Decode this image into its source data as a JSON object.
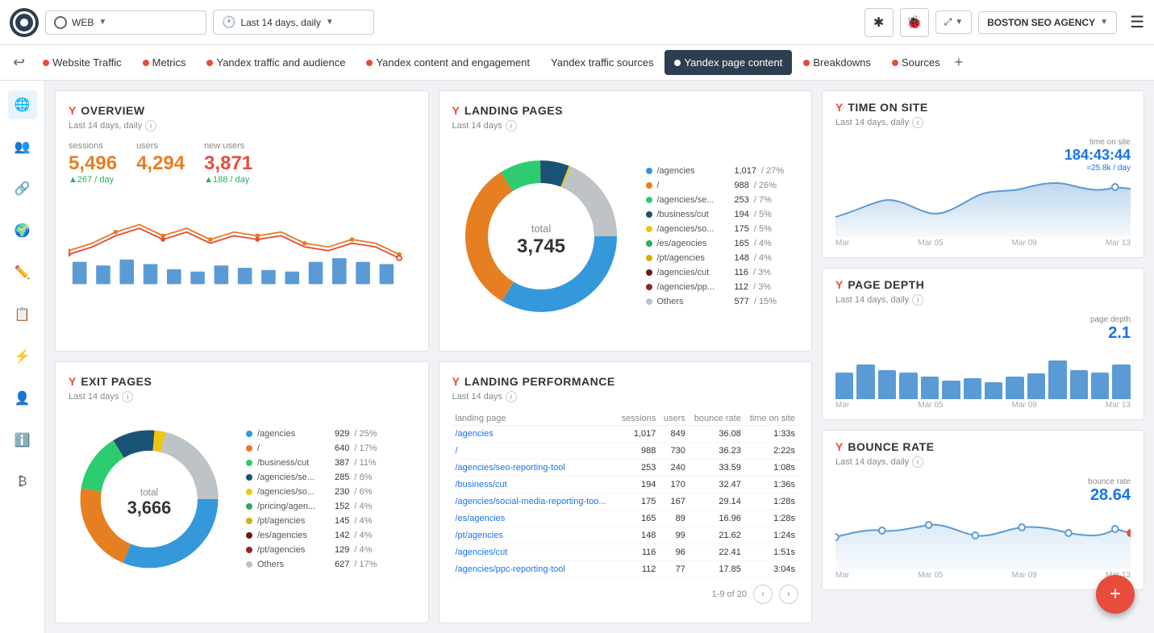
{
  "topbar": {
    "logo_label": "Logo",
    "web_label": "WEB",
    "date_label": "Last 14 days, daily",
    "agency_label": "BOSTON SEO AGENCY",
    "menu_icon": "☰"
  },
  "navbar": {
    "tabs": [
      {
        "id": "website-traffic",
        "label": "Website Traffic",
        "color": "#e74c3c",
        "active": false
      },
      {
        "id": "metrics",
        "label": "Metrics",
        "color": "#e74c3c",
        "active": false
      },
      {
        "id": "yandex-traffic",
        "label": "Yandex traffic and audience",
        "color": "#e74c3c",
        "active": false
      },
      {
        "id": "yandex-content",
        "label": "Yandex content and engagement",
        "color": "#e74c3c",
        "active": false
      },
      {
        "id": "yandex-sources",
        "label": "Yandex traffic sources",
        "color": "#e74c3c",
        "active": false
      },
      {
        "id": "yandex-page",
        "label": "Yandex page content",
        "color": "#e74c3c",
        "active": true
      },
      {
        "id": "breakdowns",
        "label": "Breakdowns",
        "color": "#e74c3c",
        "active": false
      },
      {
        "id": "sources",
        "label": "Sources",
        "color": "#e74c3c",
        "active": false
      }
    ],
    "add_label": "+"
  },
  "sidebar": {
    "icons": [
      "🌐",
      "👥",
      "🔗",
      "🌍",
      "✏️",
      "📋",
      "⚡",
      "👤",
      "ℹ️",
      "₿"
    ]
  },
  "overview": {
    "title": "OVERVIEW",
    "subtitle": "Last 14 days, daily",
    "sessions_label": "sessions",
    "sessions_value": "5,496",
    "sessions_change": "▲267 / day",
    "users_label": "users",
    "users_value": "4,294",
    "new_users_label": "new users",
    "new_users_value": "3,871",
    "new_users_change": "▲188 / day"
  },
  "landing_pages": {
    "title": "LANDING PAGES",
    "subtitle": "Last 14 days",
    "total_label": "total",
    "total_value": "3,745",
    "items": [
      {
        "name": "/agencies",
        "value": "1,017",
        "pct": "27%",
        "color": "#3498db"
      },
      {
        "name": "/",
        "value": "988",
        "pct": "26%",
        "color": "#e67e22"
      },
      {
        "name": "/agencies/se...",
        "value": "253",
        "pct": "7%",
        "color": "#2ecc71"
      },
      {
        "name": "/business/cut",
        "value": "194",
        "pct": "5%",
        "color": "#1a5276"
      },
      {
        "name": "/agencies/so...",
        "value": "175",
        "pct": "5%",
        "color": "#f1c40f"
      },
      {
        "name": "/es/agencies",
        "value": "165",
        "pct": "4%",
        "color": "#27ae60"
      },
      {
        "name": "/pt/agencies",
        "value": "148",
        "pct": "4%",
        "color": "#d4ac0d"
      },
      {
        "name": "/agencies/cut",
        "value": "116",
        "pct": "3%",
        "color": "#6c1a1a"
      },
      {
        "name": "/agencies/pp...",
        "value": "112",
        "pct": "3%",
        "color": "#922b21"
      },
      {
        "name": "Others",
        "value": "577",
        "pct": "15%",
        "color": "#bdc3c7"
      }
    ]
  },
  "exit_pages": {
    "title": "EXIT PAGES",
    "subtitle": "Last 14 days",
    "total_label": "total",
    "total_value": "3,666",
    "items": [
      {
        "name": "/agencies",
        "value": "929",
        "pct": "25%",
        "color": "#3498db"
      },
      {
        "name": "/",
        "value": "640",
        "pct": "17%",
        "color": "#e67e22"
      },
      {
        "name": "/business/cut",
        "value": "387",
        "pct": "11%",
        "color": "#2ecc71"
      },
      {
        "name": "/agencies/se...",
        "value": "285",
        "pct": "8%",
        "color": "#1a5276"
      },
      {
        "name": "/agencies/so...",
        "value": "230",
        "pct": "6%",
        "color": "#f1c40f"
      },
      {
        "name": "/pricing/agen...",
        "value": "152",
        "pct": "4%",
        "color": "#27ae60"
      },
      {
        "name": "/pt/agencies",
        "value": "145",
        "pct": "4%",
        "color": "#d4ac0d"
      },
      {
        "name": "/es/agencies",
        "value": "142",
        "pct": "4%",
        "color": "#6c1a1a"
      },
      {
        "name": "/pt/agencies",
        "value": "129",
        "pct": "4%",
        "color": "#922b21"
      },
      {
        "name": "Others",
        "value": "627",
        "pct": "17%",
        "color": "#bdc3c7"
      }
    ]
  },
  "landing_perf": {
    "title": "LANDING PERFORMANCE",
    "subtitle": "Last 14 days",
    "col_landing": "landing page",
    "col_sessions": "sessions",
    "col_users": "users",
    "col_bounce": "bounce rate",
    "col_time": "time on site",
    "rows": [
      {
        "page": "/agencies",
        "sessions": "1,017",
        "users": "849",
        "bounce": "36.08",
        "time": "1:33s"
      },
      {
        "page": "/",
        "sessions": "988",
        "users": "730",
        "bounce": "36.23",
        "time": "2:22s"
      },
      {
        "page": "/agencies/seo-reporting-tool",
        "sessions": "253",
        "users": "240",
        "bounce": "33.59",
        "time": "1:08s"
      },
      {
        "page": "/business/cut",
        "sessions": "194",
        "users": "170",
        "bounce": "32.47",
        "time": "1:36s"
      },
      {
        "page": "/agencies/social-media-reporting-too...",
        "sessions": "175",
        "users": "167",
        "bounce": "29.14",
        "time": "1:28s"
      },
      {
        "page": "/es/agencies",
        "sessions": "165",
        "users": "89",
        "bounce": "16.96",
        "time": "1:28s"
      },
      {
        "page": "/pt/agencies",
        "sessions": "148",
        "users": "99",
        "bounce": "21.62",
        "time": "1:24s"
      },
      {
        "page": "/agencies/cut",
        "sessions": "116",
        "users": "96",
        "bounce": "22.41",
        "time": "1:51s"
      },
      {
        "page": "/agencies/ppc-reporting-tool",
        "sessions": "112",
        "users": "77",
        "bounce": "17.85",
        "time": "3:04s"
      }
    ],
    "pagination": "1-9 of 20"
  },
  "time_on_site": {
    "title": "TIME ON SITE",
    "subtitle": "Last 14 days, daily",
    "label": "time on site",
    "value": "184:43:44",
    "sub_value": "≈25.8k / day",
    "axes": [
      "Mar",
      "Mar 05",
      "Mar 09",
      "Mar 13"
    ]
  },
  "page_depth": {
    "title": "PAGE DEPTH",
    "subtitle": "Last 14 days, daily",
    "label": "page depth",
    "value": "2.1",
    "axes": [
      "Mar",
      "Mar 05",
      "Mar 09",
      "Mar 13"
    ],
    "bars": [
      60,
      80,
      70,
      65,
      55,
      45,
      50,
      40,
      55,
      60,
      90,
      70,
      65,
      80
    ]
  },
  "bounce_rate": {
    "title": "BOUNCE RATE",
    "subtitle": "Last 14 days, daily",
    "label": "bounce rate",
    "value": "28.64",
    "axes": [
      "Mar",
      "Mar 05",
      "Mar 09",
      "Mar 13"
    ]
  },
  "fab": {
    "label": "+"
  }
}
